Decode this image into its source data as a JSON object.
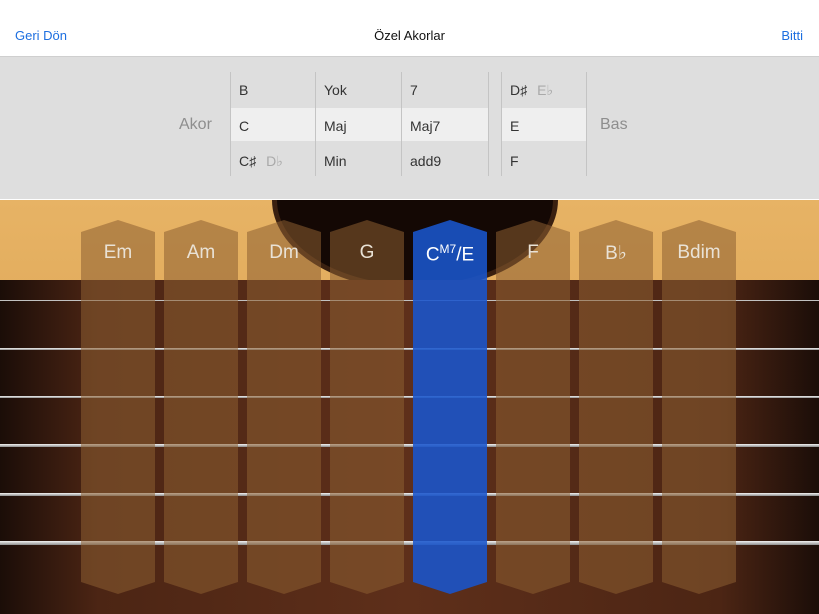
{
  "nav": {
    "back": "Geri Dön",
    "title": "Özel Akorlar",
    "done": "Bitti"
  },
  "picker": {
    "chord_label": "Akor",
    "bass_label": "Bas",
    "root": {
      "top": "B",
      "selected": "C",
      "bottom": "C♯",
      "bottom_alt": "D♭"
    },
    "quality": {
      "top": "Yok",
      "selected": "Maj",
      "bottom": "Min"
    },
    "extension": {
      "top": "7",
      "selected": "Maj7",
      "bottom": "add9"
    },
    "bass": {
      "top": "D♯",
      "top_alt": "E♭",
      "selected": "E",
      "bottom": "F"
    }
  },
  "strips": [
    {
      "label": "Em"
    },
    {
      "label": "Am"
    },
    {
      "label": "Dm"
    },
    {
      "label": "G"
    },
    {
      "label": "C",
      "sup": "M7",
      "suffix": "/E",
      "active": true
    },
    {
      "label": "F"
    },
    {
      "label": "B♭"
    },
    {
      "label": "Bdim"
    }
  ]
}
